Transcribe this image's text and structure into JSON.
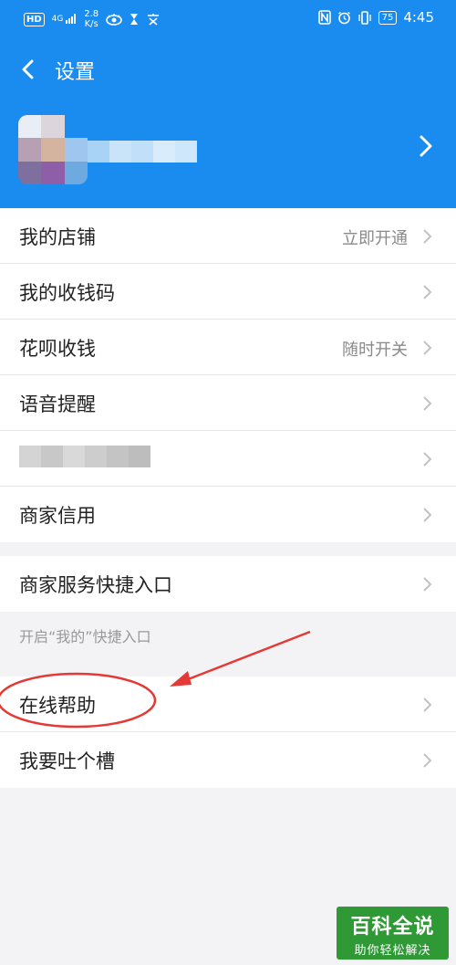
{
  "status_bar": {
    "left_badge": "HD",
    "network": "4G",
    "speed_value": "2.8",
    "speed_unit": "K/s",
    "battery": "75",
    "time": "4:45"
  },
  "nav": {
    "title": "设置"
  },
  "menu_group_1": [
    {
      "label": "我的店铺",
      "value": "立即开通"
    },
    {
      "label": "我的收钱码",
      "value": ""
    },
    {
      "label": "花呗收钱",
      "value": "随时开关"
    },
    {
      "label": "语音提醒",
      "value": ""
    },
    {
      "label": "",
      "value": ""
    },
    {
      "label": "商家信用",
      "value": ""
    }
  ],
  "menu_group_2": [
    {
      "label": "商家服务快捷入口",
      "value": ""
    }
  ],
  "hint_text": "开启“我的”快捷入口",
  "menu_group_3": [
    {
      "label": "在线帮助",
      "value": ""
    },
    {
      "label": "我要吐个槽",
      "value": ""
    }
  ],
  "watermark": {
    "main": "百科全说",
    "sub": "助你轻松解决"
  },
  "colors": {
    "header_bg": "#1a8cf0",
    "annotation_red": "#e53935",
    "watermark_bg": "#2f9a35"
  }
}
